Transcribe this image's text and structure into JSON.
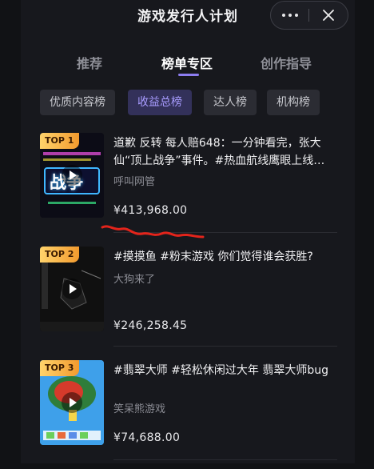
{
  "header": {
    "title": "游戏发行人计划"
  },
  "tabs": [
    {
      "label": "推荐"
    },
    {
      "label": "榜单专区"
    },
    {
      "label": "创作指导"
    }
  ],
  "active_tab": "榜单专区",
  "chips": [
    {
      "label": "优质内容榜"
    },
    {
      "label": "收益总榜"
    },
    {
      "label": "达人榜"
    },
    {
      "label": "机构榜"
    }
  ],
  "active_chip": "收益总榜",
  "items": [
    {
      "rank": "TOP 1",
      "title": "道歉 反转 每人赔648：一分钟看完，张大仙“顶上战争”事件。#热血航线鹰眼上线…",
      "author": "呼叫网管",
      "earnings": "¥413,968.00",
      "thumb_text": "战争"
    },
    {
      "rank": "TOP 2",
      "title": "#摸摸鱼 #粉末游戏 你们觉得谁会获胜?",
      "author": "大狗来了",
      "earnings": "¥246,258.45"
    },
    {
      "rank": "TOP 3",
      "title": "#翡翠大师 #轻松休闲过大年 翡翠大师bug",
      "author": "笑呆熊游戏",
      "earnings": "¥74,688.00"
    }
  ],
  "colors": {
    "accent": "#8d7df0",
    "chip_active_text": "#a89cff",
    "badge_gold": "#f2a233",
    "annotation_red": "#e3241b"
  }
}
